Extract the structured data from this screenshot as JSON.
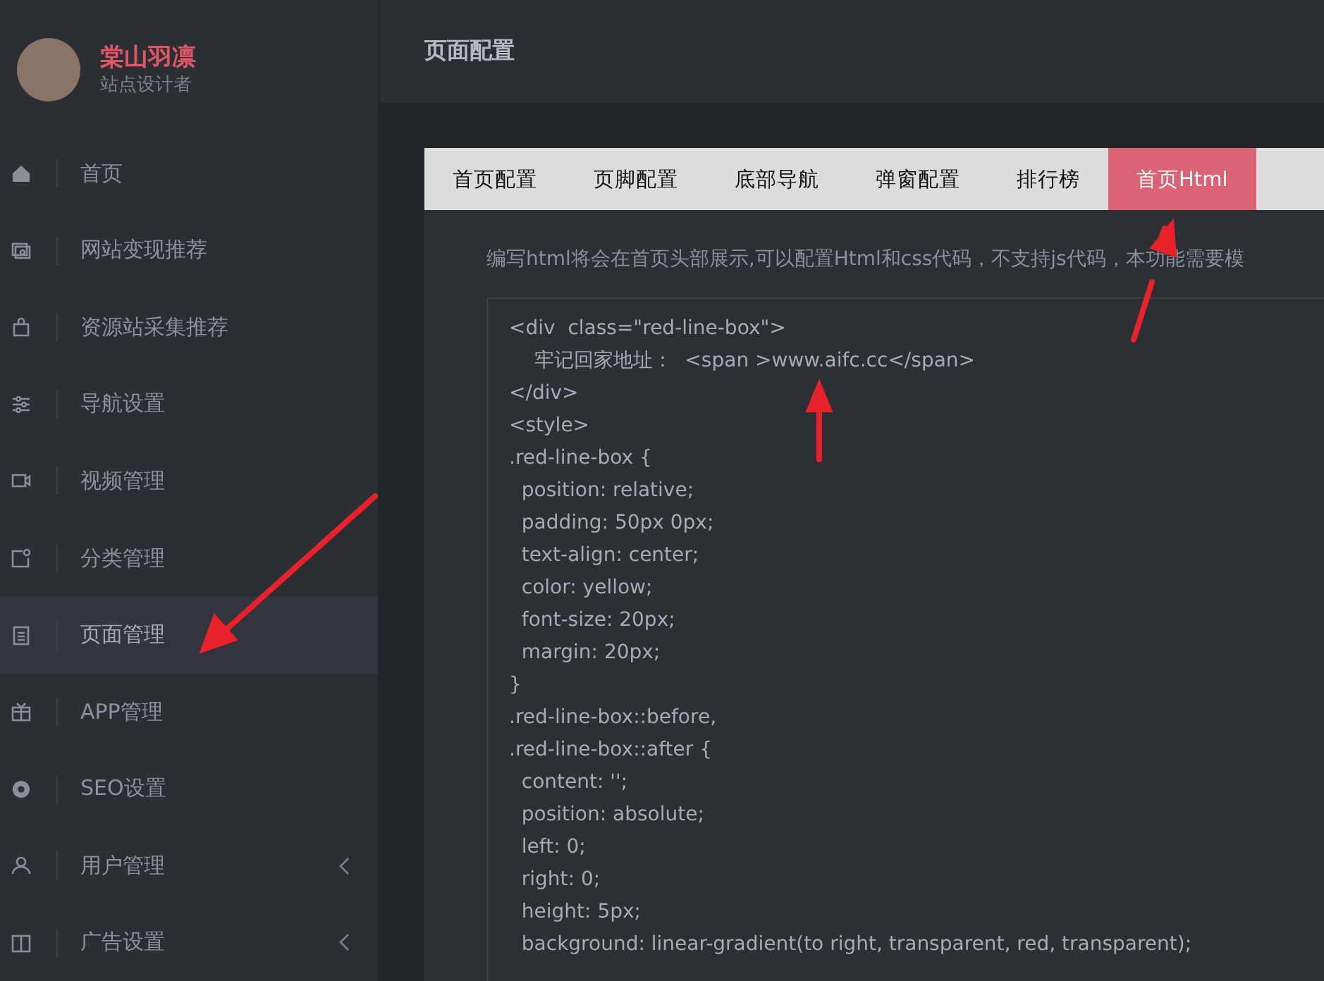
{
  "profile": {
    "name": "棠山羽凛",
    "role": "站点设计者"
  },
  "sidebar": {
    "items": [
      {
        "label": "首页",
        "selected": false,
        "has_submenu": false
      },
      {
        "label": "网站变现推荐",
        "selected": false,
        "has_submenu": false
      },
      {
        "label": "资源站采集推荐",
        "selected": false,
        "has_submenu": false
      },
      {
        "label": "导航设置",
        "selected": false,
        "has_submenu": false
      },
      {
        "label": "视频管理",
        "selected": false,
        "has_submenu": false
      },
      {
        "label": "分类管理",
        "selected": false,
        "has_submenu": false
      },
      {
        "label": "页面管理",
        "selected": true,
        "has_submenu": false
      },
      {
        "label": "APP管理",
        "selected": false,
        "has_submenu": false
      },
      {
        "label": "SEO设置",
        "selected": false,
        "has_submenu": false
      },
      {
        "label": "用户管理",
        "selected": false,
        "has_submenu": true
      },
      {
        "label": "广告设置",
        "selected": false,
        "has_submenu": true
      }
    ]
  },
  "header": {
    "title": "页面配置"
  },
  "tabs": [
    {
      "label": "首页配置",
      "selected": false
    },
    {
      "label": "页脚配置",
      "selected": false
    },
    {
      "label": "底部导航",
      "selected": false
    },
    {
      "label": "弹窗配置",
      "selected": false
    },
    {
      "label": "排行榜",
      "selected": false
    },
    {
      "label": "首页Html",
      "selected": true
    }
  ],
  "description": "编写html将会在首页头部展示,可以配置Html和css代码，不支持js代码，本功能需要模",
  "code_lines": [
    "<div  class=\"red-line-box\">",
    "    牢记回家地址：  <span >www.aifc.cc</span>",
    "</div>",
    "<style>",
    ".red-line-box {",
    "  position: relative;",
    "  padding: 50px 0px;",
    "  text-align: center;",
    "  color: yellow;",
    "  font-size: 20px;",
    "  margin: 20px;",
    "}",
    ".red-line-box::before,",
    ".red-line-box::after {",
    "  content: '';",
    "  position: absolute;",
    "  left: 0;",
    "  right: 0;",
    "  height: 5px;",
    "  background: linear-gradient(to right, transparent, red, transparent);"
  ]
}
